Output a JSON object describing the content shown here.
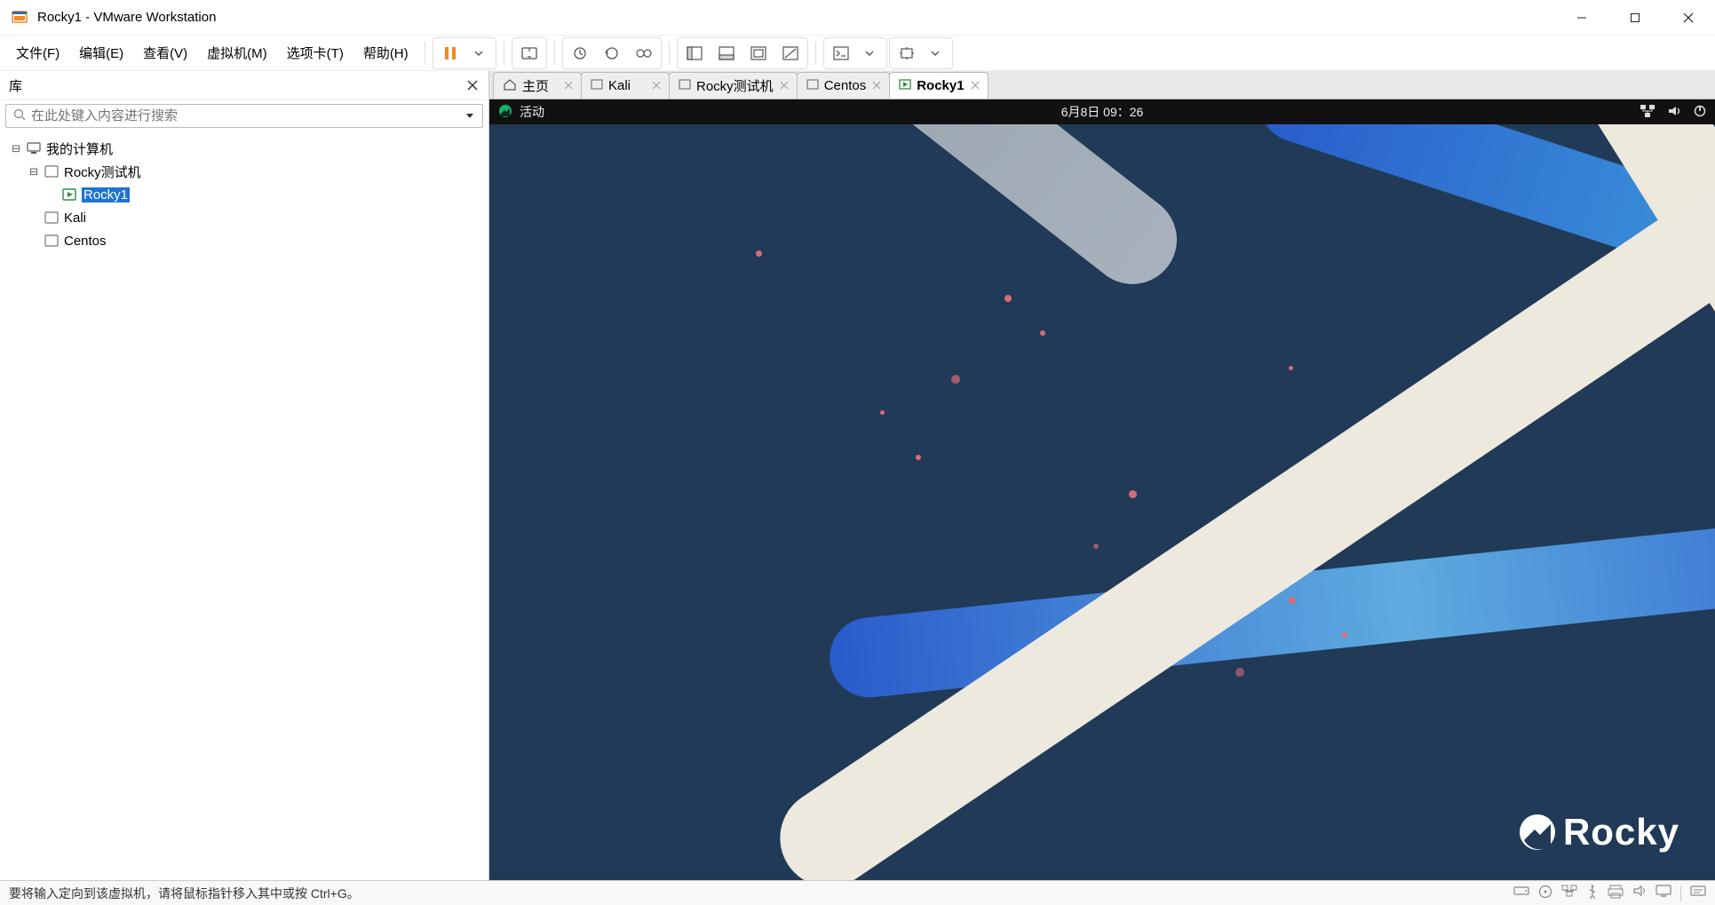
{
  "window": {
    "title": "Rocky1 - VMware Workstation"
  },
  "menu": {
    "file": "文件(F)",
    "edit": "编辑(E)",
    "view": "查看(V)",
    "vm": "虚拟机(M)",
    "tabs": "选项卡(T)",
    "help": "帮助(H)"
  },
  "sidebar": {
    "title": "库",
    "search_placeholder": "在此处键入内容进行搜索",
    "root": "我的计算机",
    "items": {
      "rocky_group": "Rocky测试机",
      "rocky1": "Rocky1",
      "kali": "Kali",
      "centos": "Centos"
    }
  },
  "tabs": {
    "home": "主页",
    "kali": "Kali",
    "rockyT": "Rocky测试机",
    "centos": "Centos",
    "rocky1": "Rocky1"
  },
  "guest": {
    "activities": "活动",
    "datetime": "6月8日 09：26",
    "brand": "Rocky"
  },
  "status": {
    "message": "要将输入定向到该虚拟机，请将鼠标指针移入其中或按 Ctrl+G。"
  }
}
